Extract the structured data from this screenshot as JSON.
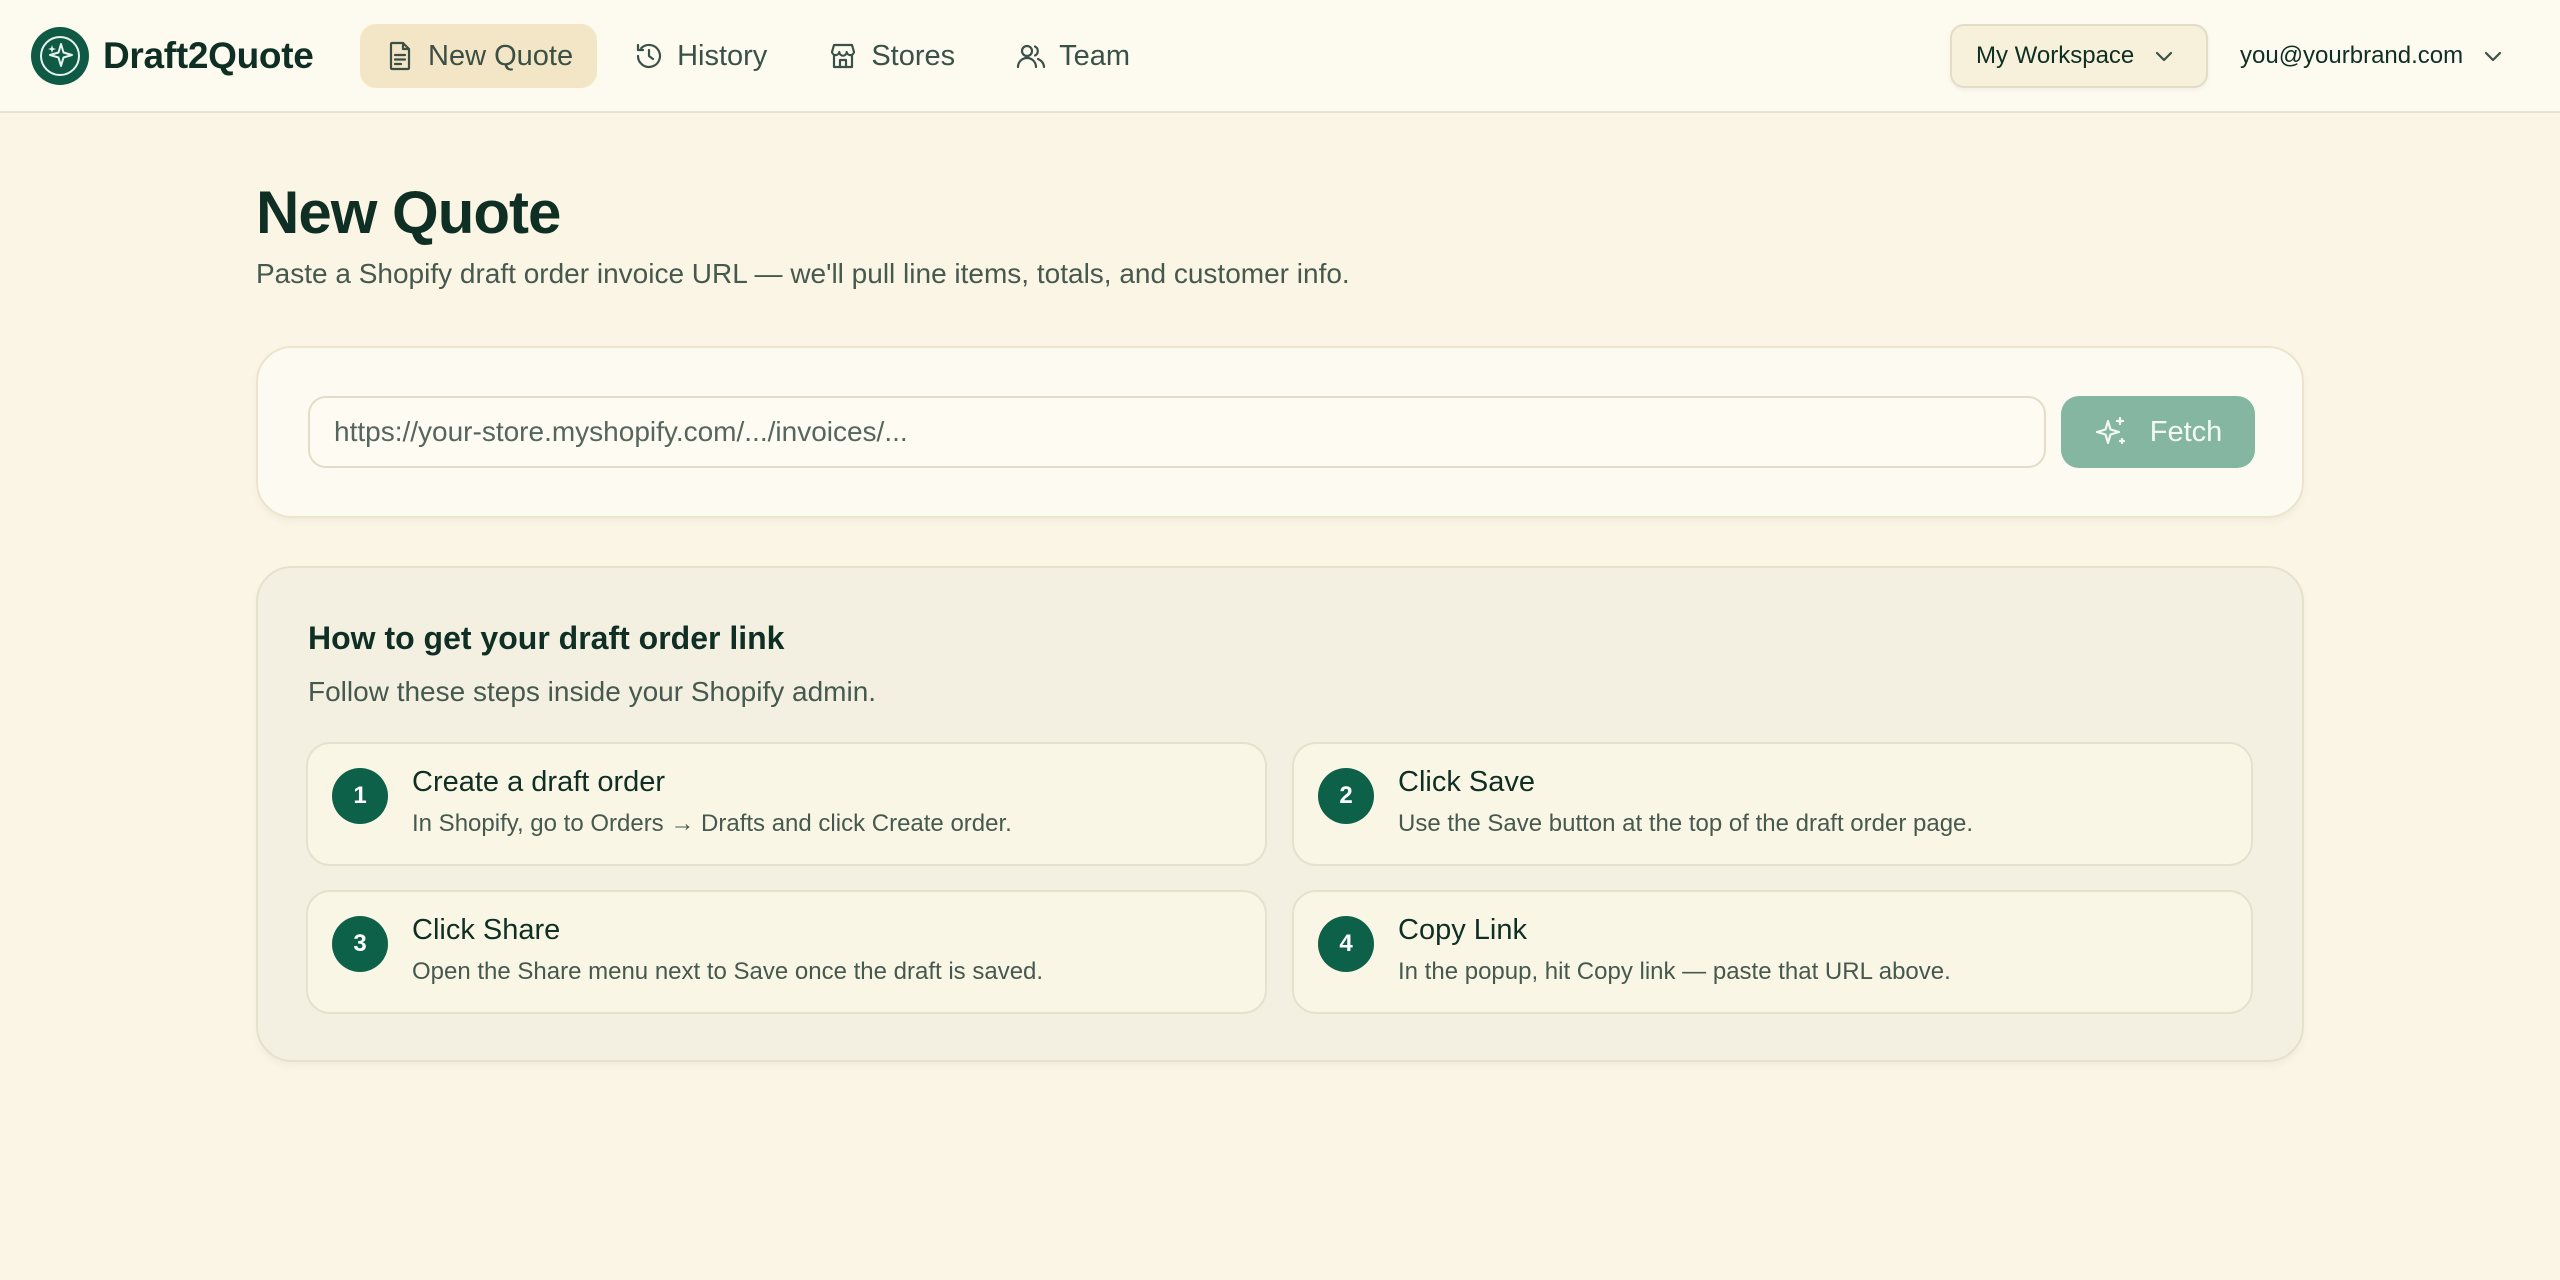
{
  "app": {
    "name": "Draft2Quote",
    "accent": "#0f5a45"
  },
  "nav": [
    {
      "label": "New Quote",
      "icon": "document-icon",
      "active": true
    },
    {
      "label": "History",
      "icon": "history-icon",
      "active": false
    },
    {
      "label": "Stores",
      "icon": "store-icon",
      "active": false
    },
    {
      "label": "Team",
      "icon": "users-icon",
      "active": false
    }
  ],
  "header": {
    "workspace_label": "My Workspace",
    "user_email": "you@yourbrand.com"
  },
  "page": {
    "title": "New Quote",
    "subtitle": "Paste a Shopify draft order invoice URL — we'll pull line items, totals, and customer info."
  },
  "url_form": {
    "placeholder": "https://your-store.myshopify.com/.../invoices/...",
    "value": "",
    "fetch_label": "Fetch"
  },
  "howto": {
    "title": "How to get your draft order link",
    "subtitle": "Follow these steps inside your Shopify admin.",
    "steps": [
      {
        "num": "1",
        "title": "Create a draft order",
        "desc": "In Shopify, go to Orders → Drafts and click Create order."
      },
      {
        "num": "2",
        "title": "Click Save",
        "desc": "Use the Save button at the top of the draft order page."
      },
      {
        "num": "3",
        "title": "Click Share",
        "desc": "Open the Share menu next to Save once the draft is saved."
      },
      {
        "num": "4",
        "title": "Copy Link",
        "desc": "In the popup, hit Copy link — paste that URL above."
      }
    ]
  }
}
